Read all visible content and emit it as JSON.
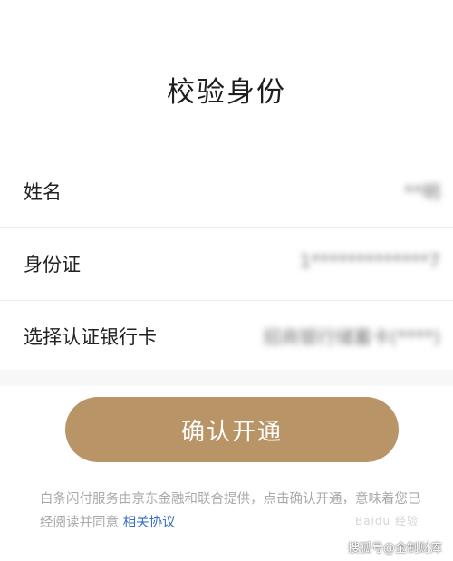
{
  "header": {
    "title": "校验身份"
  },
  "form": {
    "rows": [
      {
        "label": "姓名",
        "value": "**明"
      },
      {
        "label": "身份证",
        "value": "1*************7"
      },
      {
        "label": "选择认证银行卡",
        "value": "招商银行储蓄卡(****)"
      }
    ]
  },
  "actions": {
    "confirm_label": "确认开通"
  },
  "notice": {
    "text": "白条闪付服务由京东金融和联合提供，点击确认开通，意味着您已经阅读并同意",
    "link": "相关协议"
  },
  "watermarks": {
    "site": "Baidu 经验",
    "source": "搜狐号@金制财库"
  }
}
